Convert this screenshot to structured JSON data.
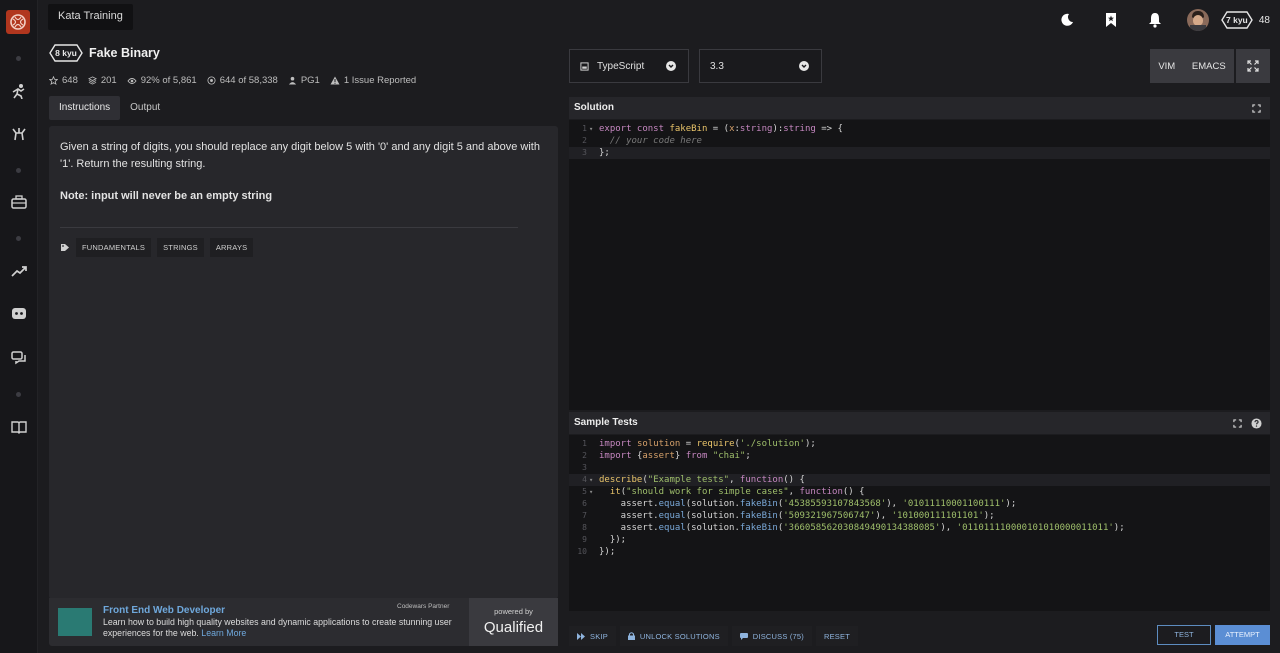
{
  "breadcrumb": "Kata Training",
  "user": {
    "rank": "7 kyu",
    "honor": "48"
  },
  "kata": {
    "rank": "8 kyu",
    "name": "Fake Binary",
    "stats": {
      "stars": "648",
      "collections": "201",
      "satisfaction": "92% of 5,861",
      "completed": "644 of 58,338",
      "author": "PG1",
      "issues": "1 Issue Reported"
    },
    "tabs": [
      "Instructions",
      "Output"
    ],
    "description": "Given a string of digits, you should replace any digit below 5 with '0' and any digit 5 and above with '1'. Return the resulting string.",
    "note": "Note: input will never be an empty string",
    "tags": [
      "FUNDAMENTALS",
      "STRINGS",
      "ARRAYS"
    ]
  },
  "ad": {
    "title": "Front End Web Developer",
    "partner": "Codewars Partner",
    "body": "Learn how to build high quality websites and dynamic applications to create stunning user experiences for the web.",
    "learn_more": "Learn More",
    "powered_by": "powered by",
    "brand": "Qualified"
  },
  "editor": {
    "language": "TypeScript",
    "version": "3.3",
    "keymaps": [
      "VIM",
      "EMACS"
    ],
    "solution_title": "Solution",
    "tests_title": "Sample Tests"
  },
  "actions": {
    "skip": "SKIP",
    "unlock": "UNLOCK SOLUTIONS",
    "discuss": "DISCUSS (75)",
    "reset": "RESET",
    "test": "TEST",
    "attempt": "ATTEMPT"
  },
  "colors": {
    "accent": "#b1361e",
    "primary": "#5b8ed4",
    "link": "#6fa8dc"
  },
  "solution_code": [
    "export const fakeBin = (x:string):string => {",
    "  // your code here",
    "};"
  ],
  "tests_code": [
    "import solution = require('./solution');",
    "import {assert} from \"chai\";",
    "",
    "describe(\"Example tests\", function() {",
    "  it(\"should work for simple cases\", function() {",
    "    assert.equal(solution.fakeBin('45385593107843568'), '01011110001100111');",
    "    assert.equal(solution.fakeBin('509321967506747'), '101000111101101');",
    "    assert.equal(solution.fakeBin('366058562030849490134388085'), '011011110000101010000011011');",
    "  });",
    "});"
  ]
}
